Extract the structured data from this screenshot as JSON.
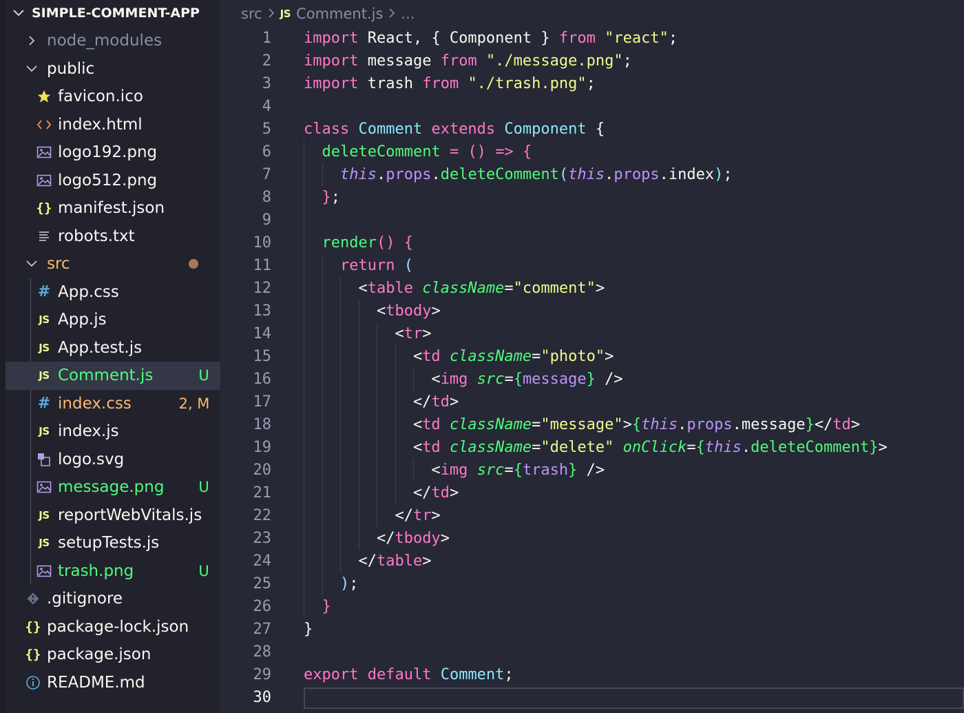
{
  "explorer": {
    "project_name": "SIMPLE-COMMENT-APP",
    "items": [
      {
        "label": "node_modules",
        "type": "folder-collapsed",
        "depth": 0,
        "icon": "chevron-right-icon",
        "color": "#8a8ea3"
      },
      {
        "label": "public",
        "type": "folder-expanded",
        "depth": 0,
        "icon": "chevron-down-icon",
        "color": "#f8f8f2"
      },
      {
        "label": "favicon.ico",
        "type": "file",
        "depth": 1,
        "icon": "star-icon",
        "glyph": "★",
        "color": "#f8f8f2"
      },
      {
        "label": "index.html",
        "type": "file",
        "depth": 1,
        "icon": "html-icon",
        "glyph": "<>",
        "color": "#f8f8f2"
      },
      {
        "label": "logo192.png",
        "type": "file",
        "depth": 1,
        "icon": "image-icon",
        "glyph": "img",
        "color": "#f8f8f2"
      },
      {
        "label": "logo512.png",
        "type": "file",
        "depth": 1,
        "icon": "image-icon",
        "glyph": "img",
        "color": "#f8f8f2"
      },
      {
        "label": "manifest.json",
        "type": "file",
        "depth": 1,
        "icon": "json-icon",
        "glyph": "{}",
        "color": "#f8f8f2"
      },
      {
        "label": "robots.txt",
        "type": "file",
        "depth": 1,
        "icon": "text-file-icon",
        "glyph": "≡",
        "color": "#f8f8f2"
      },
      {
        "label": "src",
        "type": "folder-expanded",
        "depth": 0,
        "icon": "chevron-down-icon",
        "color": "#ffb86c",
        "dot": true
      },
      {
        "label": "App.css",
        "type": "file",
        "depth": 1,
        "icon": "css-icon",
        "glyph": "#",
        "color": "#f8f8f2"
      },
      {
        "label": "App.js",
        "type": "file",
        "depth": 1,
        "icon": "javascript-icon",
        "glyph": "JS",
        "color": "#f8f8f2"
      },
      {
        "label": "App.test.js",
        "type": "file",
        "depth": 1,
        "icon": "javascript-icon",
        "glyph": "JS",
        "color": "#f8f8f2"
      },
      {
        "label": "Comment.js",
        "type": "file",
        "depth": 1,
        "icon": "javascript-icon",
        "glyph": "JS",
        "color": "#50fa7b",
        "badge": "U",
        "badge_color": "#50fa7b",
        "selected": true
      },
      {
        "label": "index.css",
        "type": "file",
        "depth": 1,
        "icon": "css-icon",
        "glyph": "#",
        "color": "#ffb86c",
        "badge": "2, M",
        "badge_color": "#ffb86c"
      },
      {
        "label": "index.js",
        "type": "file",
        "depth": 1,
        "icon": "javascript-icon",
        "glyph": "JS",
        "color": "#f8f8f2"
      },
      {
        "label": "logo.svg",
        "type": "file",
        "depth": 1,
        "icon": "svg-icon",
        "glyph": "svg",
        "color": "#f8f8f2"
      },
      {
        "label": "message.png",
        "type": "file",
        "depth": 1,
        "icon": "image-icon",
        "glyph": "img",
        "color": "#50fa7b",
        "badge": "U",
        "badge_color": "#50fa7b"
      },
      {
        "label": "reportWebVitals.js",
        "type": "file",
        "depth": 1,
        "icon": "javascript-icon",
        "glyph": "JS",
        "color": "#f8f8f2"
      },
      {
        "label": "setupTests.js",
        "type": "file",
        "depth": 1,
        "icon": "javascript-icon",
        "glyph": "JS",
        "color": "#f8f8f2"
      },
      {
        "label": "trash.png",
        "type": "file",
        "depth": 1,
        "icon": "image-icon",
        "glyph": "img",
        "color": "#50fa7b",
        "badge": "U",
        "badge_color": "#50fa7b"
      },
      {
        "label": ".gitignore",
        "type": "file",
        "depth": 0,
        "icon": "git-icon",
        "glyph": "git",
        "color": "#f8f8f2"
      },
      {
        "label": "package-lock.json",
        "type": "file",
        "depth": 0,
        "icon": "json-icon",
        "glyph": "{}",
        "color": "#f8f8f2"
      },
      {
        "label": "package.json",
        "type": "file",
        "depth": 0,
        "icon": "json-icon",
        "glyph": "{}",
        "color": "#f8f8f2"
      },
      {
        "label": "README.md",
        "type": "file",
        "depth": 0,
        "icon": "info-icon",
        "glyph": "i",
        "color": "#f8f8f2"
      }
    ]
  },
  "breadcrumb": {
    "folder": "src",
    "file_icon": "JS",
    "file": "Comment.js",
    "more": "..."
  },
  "editor": {
    "active_line": 30,
    "lines": [
      [
        [
          "import",
          "kw"
        ],
        [
          " React, { Component } ",
          ""
        ],
        [
          "from",
          "kw"
        ],
        [
          " ",
          ""
        ],
        [
          "\"react\"",
          "str"
        ],
        [
          ";",
          ""
        ]
      ],
      [
        [
          "import",
          "kw"
        ],
        [
          " message ",
          ""
        ],
        [
          "from",
          "kw"
        ],
        [
          " ",
          ""
        ],
        [
          "\"./message.png\"",
          "str"
        ],
        [
          ";",
          ""
        ]
      ],
      [
        [
          "import",
          "kw"
        ],
        [
          " trash ",
          ""
        ],
        [
          "from",
          "kw"
        ],
        [
          " ",
          ""
        ],
        [
          "\"./trash.png\"",
          "str"
        ],
        [
          ";",
          ""
        ]
      ],
      [],
      [
        [
          "class",
          "kw"
        ],
        [
          " ",
          ""
        ],
        [
          "Comment",
          "cls"
        ],
        [
          " ",
          ""
        ],
        [
          "extends",
          "kw"
        ],
        [
          " ",
          ""
        ],
        [
          "Component",
          "cls"
        ],
        [
          " {",
          ""
        ]
      ],
      [
        [
          "  ",
          ""
        ],
        [
          "deleteComment",
          "fn"
        ],
        [
          " ",
          ""
        ],
        [
          "=",
          "op"
        ],
        [
          " ",
          ""
        ],
        [
          "()",
          "kw"
        ],
        [
          " ",
          ""
        ],
        [
          "=>",
          "op"
        ],
        [
          " ",
          ""
        ],
        [
          "{",
          "kw"
        ]
      ],
      [
        [
          "    ",
          ""
        ],
        [
          "this",
          "this"
        ],
        [
          ".",
          ""
        ],
        [
          "props",
          "prop"
        ],
        [
          ".",
          ""
        ],
        [
          "deleteComment",
          "fn"
        ],
        [
          "(",
          "brc2"
        ],
        [
          "this",
          "this"
        ],
        [
          ".",
          ""
        ],
        [
          "props",
          "prop"
        ],
        [
          ".index",
          ""
        ],
        [
          ")",
          "brc2"
        ],
        [
          ";",
          ""
        ]
      ],
      [
        [
          "  ",
          ""
        ],
        [
          "}",
          "kw"
        ],
        [
          ";",
          ""
        ]
      ],
      [],
      [
        [
          "  ",
          ""
        ],
        [
          "render",
          "fn"
        ],
        [
          "()",
          "kw"
        ],
        [
          " ",
          ""
        ],
        [
          "{",
          "kw"
        ]
      ],
      [
        [
          "    ",
          ""
        ],
        [
          "return",
          "kw"
        ],
        [
          " ",
          ""
        ],
        [
          "(",
          "brc2"
        ]
      ],
      [
        [
          "      <",
          ""
        ],
        [
          "table",
          "tagp"
        ],
        [
          " ",
          ""
        ],
        [
          "className",
          "attr"
        ],
        [
          "=",
          ""
        ],
        [
          "\"comment\"",
          "str"
        ],
        [
          ">",
          ""
        ]
      ],
      [
        [
          "        <",
          ""
        ],
        [
          "tbody",
          "tagp"
        ],
        [
          ">",
          ""
        ]
      ],
      [
        [
          "          <",
          ""
        ],
        [
          "tr",
          "tagp"
        ],
        [
          ">",
          ""
        ]
      ],
      [
        [
          "            <",
          ""
        ],
        [
          "td",
          "tagp"
        ],
        [
          " ",
          ""
        ],
        [
          "className",
          "attr"
        ],
        [
          "=",
          ""
        ],
        [
          "\"photo\"",
          "str"
        ],
        [
          ">",
          ""
        ]
      ],
      [
        [
          "              <",
          ""
        ],
        [
          "img",
          "tagp"
        ],
        [
          " ",
          ""
        ],
        [
          "src",
          "attr"
        ],
        [
          "=",
          ""
        ],
        [
          "{",
          "brc"
        ],
        [
          "message",
          "prop"
        ],
        [
          "}",
          "brc"
        ],
        [
          " />",
          ""
        ]
      ],
      [
        [
          "            </",
          ""
        ],
        [
          "td",
          "tagp"
        ],
        [
          ">",
          ""
        ]
      ],
      [
        [
          "            <",
          ""
        ],
        [
          "td",
          "tagp"
        ],
        [
          " ",
          ""
        ],
        [
          "className",
          "attr"
        ],
        [
          "=",
          ""
        ],
        [
          "\"message\"",
          "str"
        ],
        [
          ">",
          ""
        ],
        [
          "{",
          "brc"
        ],
        [
          "this",
          "this"
        ],
        [
          ".",
          ""
        ],
        [
          "props",
          "prop"
        ],
        [
          ".message",
          ""
        ],
        [
          "}",
          "brc"
        ],
        [
          "</",
          ""
        ],
        [
          "td",
          "tagp"
        ],
        [
          ">",
          ""
        ]
      ],
      [
        [
          "            <",
          ""
        ],
        [
          "td",
          "tagp"
        ],
        [
          " ",
          ""
        ],
        [
          "className",
          "attr"
        ],
        [
          "=",
          ""
        ],
        [
          "\"delete\"",
          "str"
        ],
        [
          " ",
          ""
        ],
        [
          "onClick",
          "attr"
        ],
        [
          "=",
          ""
        ],
        [
          "{",
          "brc"
        ],
        [
          "this",
          "this"
        ],
        [
          ".",
          ""
        ],
        [
          "deleteComment",
          "fn"
        ],
        [
          "}",
          "brc"
        ],
        [
          ">",
          ""
        ]
      ],
      [
        [
          "              <",
          ""
        ],
        [
          "img",
          "tagp"
        ],
        [
          " ",
          ""
        ],
        [
          "src",
          "attr"
        ],
        [
          "=",
          ""
        ],
        [
          "{",
          "brc"
        ],
        [
          "trash",
          "prop"
        ],
        [
          "}",
          "brc"
        ],
        [
          " />",
          ""
        ]
      ],
      [
        [
          "            </",
          ""
        ],
        [
          "td",
          "tagp"
        ],
        [
          ">",
          ""
        ]
      ],
      [
        [
          "          </",
          ""
        ],
        [
          "tr",
          "tagp"
        ],
        [
          ">",
          ""
        ]
      ],
      [
        [
          "        </",
          ""
        ],
        [
          "tbody",
          "tagp"
        ],
        [
          ">",
          ""
        ]
      ],
      [
        [
          "      </",
          ""
        ],
        [
          "table",
          "tagp"
        ],
        [
          ">",
          ""
        ]
      ],
      [
        [
          "    ",
          ""
        ],
        [
          ")",
          "brc2"
        ],
        [
          ";",
          ""
        ]
      ],
      [
        [
          "  ",
          ""
        ],
        [
          "}",
          "kw"
        ]
      ],
      [
        [
          "}",
          ""
        ]
      ],
      [],
      [
        [
          "export",
          "kw"
        ],
        [
          " ",
          ""
        ],
        [
          "default",
          "kw"
        ],
        [
          " ",
          ""
        ],
        [
          "Comment",
          "cls"
        ],
        [
          ";",
          ""
        ]
      ],
      []
    ]
  }
}
